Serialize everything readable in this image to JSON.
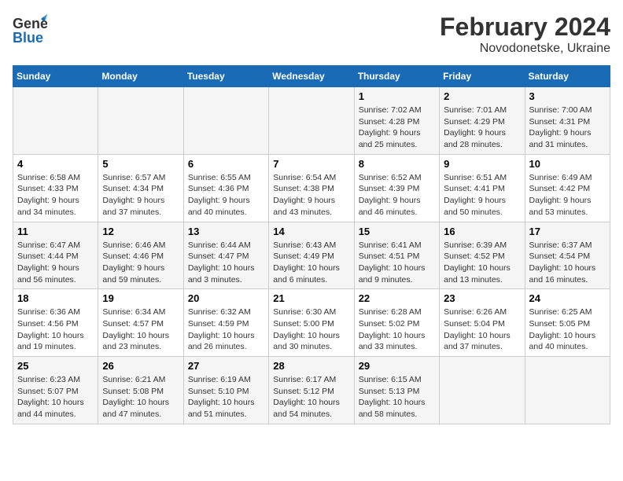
{
  "header": {
    "logo": {
      "line1": "General",
      "line2": "Blue"
    },
    "title": "February 2024",
    "subtitle": "Novodonetske, Ukraine"
  },
  "weekdays": [
    "Sunday",
    "Monday",
    "Tuesday",
    "Wednesday",
    "Thursday",
    "Friday",
    "Saturday"
  ],
  "weeks": [
    [
      {
        "day": "",
        "info": ""
      },
      {
        "day": "",
        "info": ""
      },
      {
        "day": "",
        "info": ""
      },
      {
        "day": "",
        "info": ""
      },
      {
        "day": "1",
        "info": "Sunrise: 7:02 AM\nSunset: 4:28 PM\nDaylight: 9 hours\nand 25 minutes."
      },
      {
        "day": "2",
        "info": "Sunrise: 7:01 AM\nSunset: 4:29 PM\nDaylight: 9 hours\nand 28 minutes."
      },
      {
        "day": "3",
        "info": "Sunrise: 7:00 AM\nSunset: 4:31 PM\nDaylight: 9 hours\nand 31 minutes."
      }
    ],
    [
      {
        "day": "4",
        "info": "Sunrise: 6:58 AM\nSunset: 4:33 PM\nDaylight: 9 hours\nand 34 minutes."
      },
      {
        "day": "5",
        "info": "Sunrise: 6:57 AM\nSunset: 4:34 PM\nDaylight: 9 hours\nand 37 minutes."
      },
      {
        "day": "6",
        "info": "Sunrise: 6:55 AM\nSunset: 4:36 PM\nDaylight: 9 hours\nand 40 minutes."
      },
      {
        "day": "7",
        "info": "Sunrise: 6:54 AM\nSunset: 4:38 PM\nDaylight: 9 hours\nand 43 minutes."
      },
      {
        "day": "8",
        "info": "Sunrise: 6:52 AM\nSunset: 4:39 PM\nDaylight: 9 hours\nand 46 minutes."
      },
      {
        "day": "9",
        "info": "Sunrise: 6:51 AM\nSunset: 4:41 PM\nDaylight: 9 hours\nand 50 minutes."
      },
      {
        "day": "10",
        "info": "Sunrise: 6:49 AM\nSunset: 4:42 PM\nDaylight: 9 hours\nand 53 minutes."
      }
    ],
    [
      {
        "day": "11",
        "info": "Sunrise: 6:47 AM\nSunset: 4:44 PM\nDaylight: 9 hours\nand 56 minutes."
      },
      {
        "day": "12",
        "info": "Sunrise: 6:46 AM\nSunset: 4:46 PM\nDaylight: 9 hours\nand 59 minutes."
      },
      {
        "day": "13",
        "info": "Sunrise: 6:44 AM\nSunset: 4:47 PM\nDaylight: 10 hours\nand 3 minutes."
      },
      {
        "day": "14",
        "info": "Sunrise: 6:43 AM\nSunset: 4:49 PM\nDaylight: 10 hours\nand 6 minutes."
      },
      {
        "day": "15",
        "info": "Sunrise: 6:41 AM\nSunset: 4:51 PM\nDaylight: 10 hours\nand 9 minutes."
      },
      {
        "day": "16",
        "info": "Sunrise: 6:39 AM\nSunset: 4:52 PM\nDaylight: 10 hours\nand 13 minutes."
      },
      {
        "day": "17",
        "info": "Sunrise: 6:37 AM\nSunset: 4:54 PM\nDaylight: 10 hours\nand 16 minutes."
      }
    ],
    [
      {
        "day": "18",
        "info": "Sunrise: 6:36 AM\nSunset: 4:56 PM\nDaylight: 10 hours\nand 19 minutes."
      },
      {
        "day": "19",
        "info": "Sunrise: 6:34 AM\nSunset: 4:57 PM\nDaylight: 10 hours\nand 23 minutes."
      },
      {
        "day": "20",
        "info": "Sunrise: 6:32 AM\nSunset: 4:59 PM\nDaylight: 10 hours\nand 26 minutes."
      },
      {
        "day": "21",
        "info": "Sunrise: 6:30 AM\nSunset: 5:00 PM\nDaylight: 10 hours\nand 30 minutes."
      },
      {
        "day": "22",
        "info": "Sunrise: 6:28 AM\nSunset: 5:02 PM\nDaylight: 10 hours\nand 33 minutes."
      },
      {
        "day": "23",
        "info": "Sunrise: 6:26 AM\nSunset: 5:04 PM\nDaylight: 10 hours\nand 37 minutes."
      },
      {
        "day": "24",
        "info": "Sunrise: 6:25 AM\nSunset: 5:05 PM\nDaylight: 10 hours\nand 40 minutes."
      }
    ],
    [
      {
        "day": "25",
        "info": "Sunrise: 6:23 AM\nSunset: 5:07 PM\nDaylight: 10 hours\nand 44 minutes."
      },
      {
        "day": "26",
        "info": "Sunrise: 6:21 AM\nSunset: 5:08 PM\nDaylight: 10 hours\nand 47 minutes."
      },
      {
        "day": "27",
        "info": "Sunrise: 6:19 AM\nSunset: 5:10 PM\nDaylight: 10 hours\nand 51 minutes."
      },
      {
        "day": "28",
        "info": "Sunrise: 6:17 AM\nSunset: 5:12 PM\nDaylight: 10 hours\nand 54 minutes."
      },
      {
        "day": "29",
        "info": "Sunrise: 6:15 AM\nSunset: 5:13 PM\nDaylight: 10 hours\nand 58 minutes."
      },
      {
        "day": "",
        "info": ""
      },
      {
        "day": "",
        "info": ""
      }
    ]
  ]
}
